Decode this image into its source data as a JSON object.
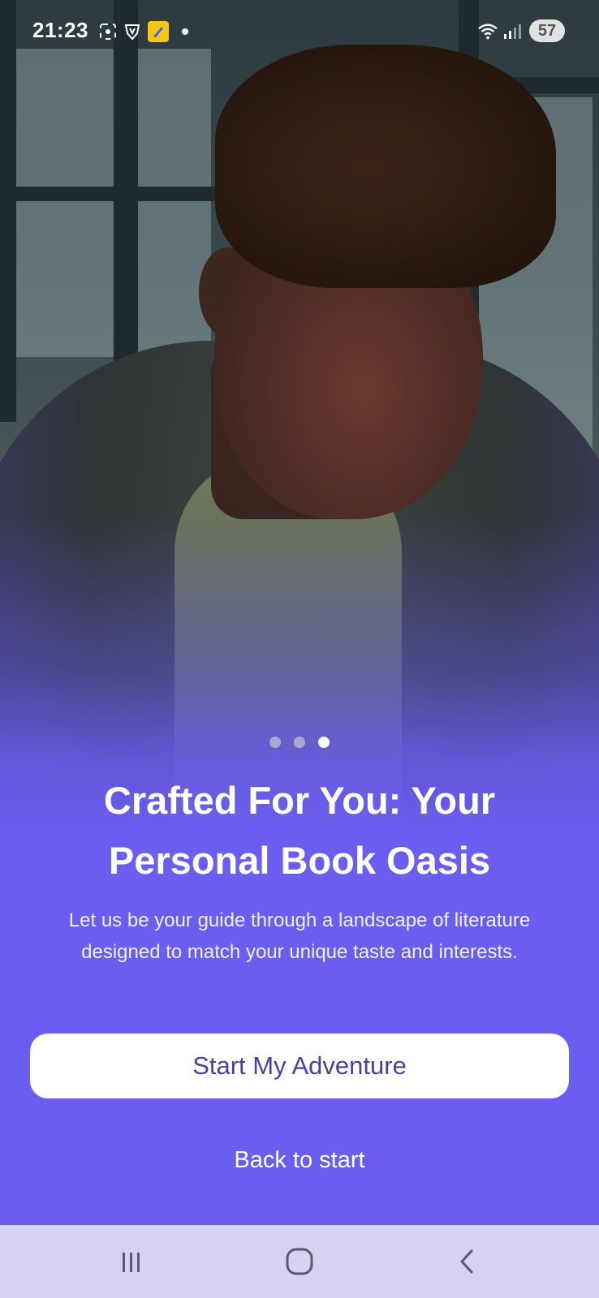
{
  "status_bar": {
    "time": "21:23",
    "battery": "57",
    "icons": [
      "screenshot-icon",
      "vpn-shield-icon",
      "app-notification-icon",
      "dot-icon",
      "wifi-icon",
      "signal-icon"
    ]
  },
  "onboarding": {
    "page_count": 3,
    "active_page": 3,
    "title": "Crafted For You: Your Personal Book Oasis",
    "subtitle": "Let us be your guide through a landscape of literature designed to match your unique taste and interests.",
    "primary_button": "Start My Adventure",
    "secondary_link": "Back to start"
  },
  "nav_bar": {
    "icons": [
      "recent-apps-icon",
      "home-icon",
      "back-icon"
    ]
  },
  "colors": {
    "accent": "#6a5df0",
    "button_text": "#4b3f9a",
    "nav_bar": "#d6d2f4"
  }
}
